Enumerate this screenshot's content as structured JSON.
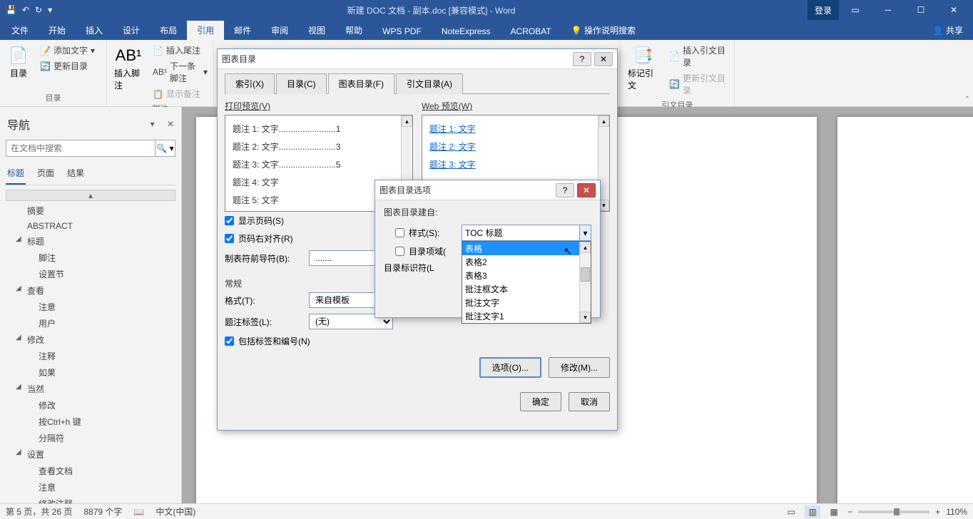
{
  "title_bar": {
    "document_title": "新建 DOC 文档 - 副本.doc [兼容模式] - Word",
    "login": "登录"
  },
  "ribbon_tabs": {
    "file": "文件",
    "home": "开始",
    "insert": "插入",
    "design": "设计",
    "layout": "布局",
    "references": "引用",
    "mailings": "邮件",
    "review": "审阅",
    "view": "视图",
    "help": "帮助",
    "wps_pdf": "WPS PDF",
    "noteexpress": "NoteExpress",
    "acrobat": "ACROBAT",
    "tell_me": "操作说明搜索",
    "share": "共享"
  },
  "ribbon": {
    "toc_group": "目录",
    "toc_btn": "目录",
    "add_text": "添加文字",
    "update_toc": "更新目录",
    "footnotes_group": "脚注",
    "insert_footnote": "插入脚注",
    "insert_endnote": "插入尾注",
    "next_footnote": "下一条脚注",
    "show_notes": "显示备注",
    "mark_citation": "标记引文",
    "citations_group": "引文目录",
    "insert_toa": "插入引文目录",
    "update_toa": "更新引文目录"
  },
  "nav": {
    "title": "导航",
    "search_placeholder": "在文档中搜索",
    "tabs": {
      "headings": "标题",
      "pages": "页面",
      "results": "结果"
    },
    "items": [
      {
        "label": "摘要",
        "level": 1
      },
      {
        "label": "ABSTRACT",
        "level": 1
      },
      {
        "label": "标题",
        "level": 1,
        "tw": "◢"
      },
      {
        "label": "脚注",
        "level": 2
      },
      {
        "label": "设置节",
        "level": 2
      },
      {
        "label": "查看",
        "level": 1,
        "tw": "◢"
      },
      {
        "label": "注意",
        "level": 2
      },
      {
        "label": "用户",
        "level": 2
      },
      {
        "label": "修改",
        "level": 1,
        "tw": "◢"
      },
      {
        "label": "注释",
        "level": 2
      },
      {
        "label": "如果",
        "level": 2
      },
      {
        "label": "当然",
        "level": 1,
        "tw": "◢"
      },
      {
        "label": "修改",
        "level": 2
      },
      {
        "label": "按Ctrl+h 键",
        "level": 2
      },
      {
        "label": "分隔符",
        "level": 2
      },
      {
        "label": "设置",
        "level": 1,
        "tw": "◢"
      },
      {
        "label": "查看文档",
        "level": 2
      },
      {
        "label": "注意",
        "level": 2
      },
      {
        "label": "修改注释",
        "level": 2
      }
    ]
  },
  "dialog1": {
    "title": "图表目录",
    "tabs": {
      "index": "索引(X)",
      "toc": "目录(C)",
      "figures": "图表目录(F)",
      "citations": "引文目录(A)"
    },
    "print_preview": "打印预览(V)",
    "web_preview": "Web 预览(W)",
    "print_rows": [
      "题注  1:  文字........................1",
      "题注  2:  文字........................3",
      "题注  3:  文字........................5",
      "题注  4:  文字",
      "题注  5:  文字"
    ],
    "web_rows": [
      "题注  1:  文字",
      "题注  2:  文字",
      "题注  3:  文字"
    ],
    "show_page_numbers": "显示页码(S)",
    "right_align": "页码右对齐(R)",
    "tab_leader": "制表符前导符(B):",
    "tab_leader_value": ".......",
    "general": "常规",
    "format": "格式(T):",
    "format_value": "来自模板",
    "caption_label": "题注标签(L):",
    "caption_label_value": "(无)",
    "include_label": "包括标签和编号(N)",
    "options_btn": "选项(O)...",
    "modify_btn": "修改(M)...",
    "ok": "确定",
    "cancel": "取消"
  },
  "dialog2": {
    "title": "图表目录选项",
    "build_from": "图表目录建自:",
    "style": "样式(S):",
    "style_value": "TOC 标题",
    "toc_fields": "目录项域(",
    "toc_id": "目录标识符(L",
    "options": [
      "表格",
      "表格2",
      "表格3",
      "批注框文本",
      "批注文字",
      "批注文字1"
    ]
  },
  "status": {
    "page": "第 5 页，共 26 页",
    "words": "8879 个字",
    "lang": "中文(中国)",
    "zoom": "110%"
  }
}
